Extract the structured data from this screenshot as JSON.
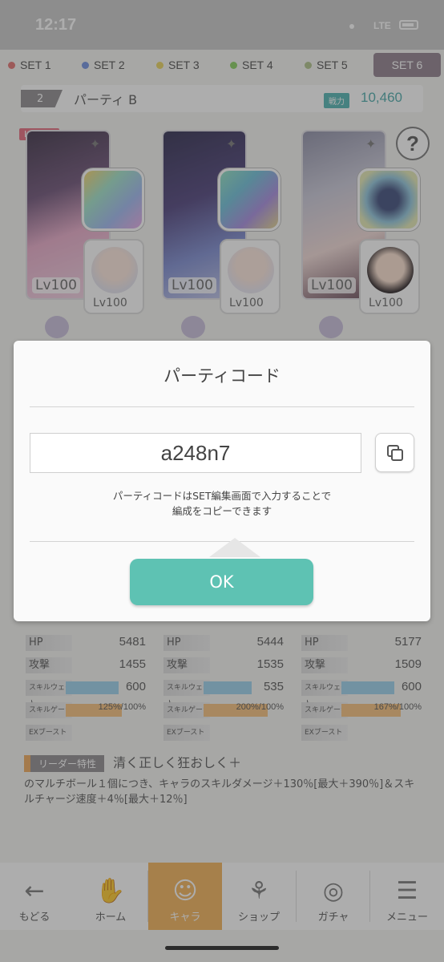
{
  "status_bar": {
    "time": "12:17",
    "network": "LTE"
  },
  "set_tabs": [
    {
      "label": "SET 1",
      "dot_color": "#e2706e",
      "active": false
    },
    {
      "label": "SET 2",
      "dot_color": "#6e8fe0",
      "active": false
    },
    {
      "label": "SET 3",
      "dot_color": "#e9d35c",
      "active": false
    },
    {
      "label": "SET 4",
      "dot_color": "#87cf5e",
      "active": false
    },
    {
      "label": "SET 5",
      "dot_color": "#aec289",
      "active": false
    },
    {
      "label": "SET 6",
      "dot_color": "",
      "active": true
    }
  ],
  "party": {
    "number": "2",
    "name": "パーティ B",
    "power_label": "戦力",
    "power_value": "10,460",
    "help_label": "?"
  },
  "leader_badge": "Leader",
  "members": [
    {
      "level": "Lv100",
      "sub_level": "Lv100"
    },
    {
      "level": "Lv100",
      "sub_level": "Lv100"
    },
    {
      "level": "Lv100",
      "sub_level": "Lv100"
    }
  ],
  "stats": [
    {
      "hp": "5481",
      "attack": "1455",
      "skill_wait": "600",
      "skill_gauge": "125%/100%"
    },
    {
      "hp": "5444",
      "attack": "1535",
      "skill_wait": "535",
      "skill_gauge": "200%/100%"
    },
    {
      "hp": "5177",
      "attack": "1509",
      "skill_wait": "600",
      "skill_gauge": "167%/100%"
    }
  ],
  "stat_labels": {
    "hp": "HP",
    "attack": "攻撃",
    "skill_wait": "スキルウェイト",
    "skill_gauge": "スキルゲージ",
    "ex_boost": "EXブースト"
  },
  "leader_skill": {
    "tag": "リーダー特性",
    "name": "清く正しく狂おしく＋",
    "description": "のマルチボール１個につき、キャラのスキルダメージ＋130％[最大＋390％]＆スキルチャージ速度＋4％[最大＋12％]"
  },
  "bottom_nav": {
    "back": "もどる",
    "items": [
      "ホーム",
      "キャラ",
      "ショップ",
      "ガチャ",
      "メニュー"
    ],
    "active": "キャラ"
  },
  "dialog": {
    "title": "パーティコード",
    "code": "a248n7",
    "note_line1": "パーティコードはSET編集画面で入力することで",
    "note_line2": "編成をコピーできます",
    "ok_label": "OK"
  }
}
